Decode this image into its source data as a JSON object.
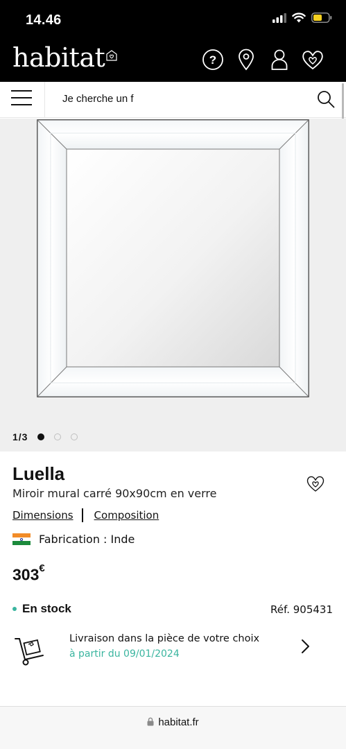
{
  "status_bar": {
    "time": "14.46",
    "icons": [
      "cellular-signal-icon",
      "wifi-icon",
      "battery-icon"
    ]
  },
  "header": {
    "logo": "habitat",
    "icons": [
      "help-icon",
      "store-locator-icon",
      "account-icon",
      "wishlist-icon"
    ]
  },
  "search": {
    "value": "Je cherche un f",
    "icons": [
      "menu-icon",
      "search-icon"
    ]
  },
  "gallery": {
    "counter": "1/3",
    "total": 3,
    "current": 1
  },
  "product": {
    "name": "Luella",
    "description": "Miroir mural carré 90x90cm en verre",
    "links": [
      "Dimensions",
      "Composition"
    ],
    "origin": "Fabrication : Inde",
    "price": "303",
    "currency": "€",
    "stock": "En stock",
    "reference": "Réf. 905431"
  },
  "delivery": {
    "title": "Livraison dans la pièce de votre choix",
    "date": "à partir du 09/01/2024"
  },
  "browser": {
    "url": "habitat.fr"
  },
  "colors": {
    "accent": "#3ab59f",
    "header_bg": "#000000",
    "gallery_bg": "#efefef",
    "flag_saffron": "#f28c28",
    "flag_green": "#1c8a3c"
  }
}
